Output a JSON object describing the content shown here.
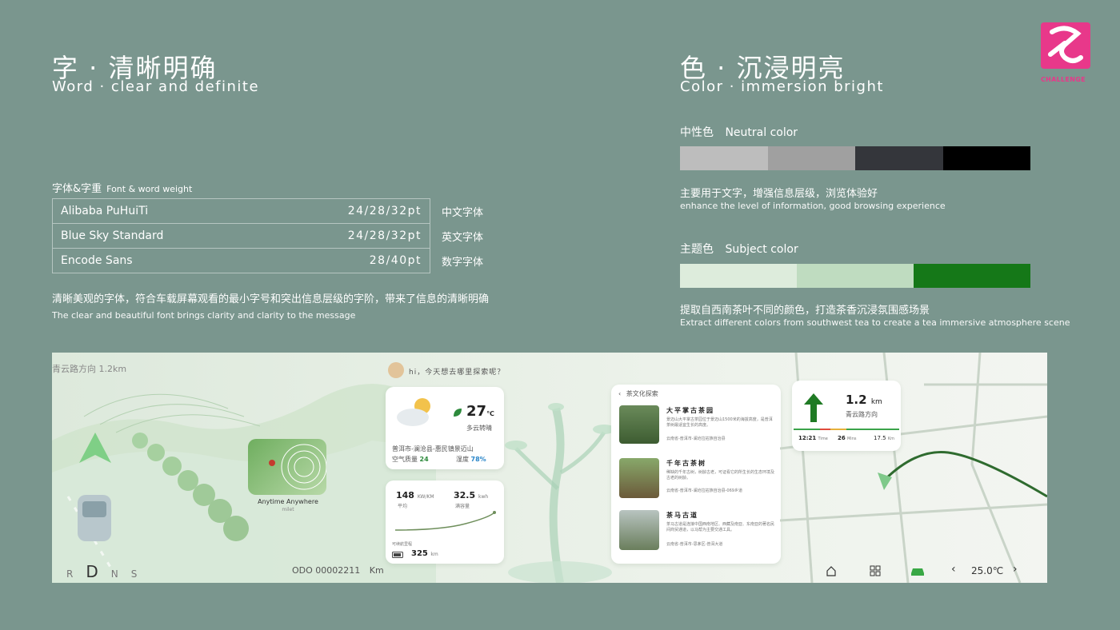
{
  "left": {
    "title_cn": "字 · 清晰明确",
    "title_en": "Word · clear and definite",
    "font_label_cn": "字体&字重",
    "font_label_en": "Font & word weight",
    "fonts": [
      {
        "name": "Alibaba PuHuiTi",
        "size": "24/28/32pt",
        "tag": "中文字体"
      },
      {
        "name": "Blue Sky Standard",
        "size": "24/28/32pt",
        "tag": "英文字体"
      },
      {
        "name": "Encode Sans",
        "size": "28/40pt",
        "tag": "数字字体"
      }
    ],
    "desc_cn": "清晰美观的字体，符合车载屏幕观看的最小字号和突出信息层级的字阶，带来了信息的清晰明确",
    "desc_en": "The clear and beautiful font brings clarity and clarity to the message"
  },
  "right": {
    "title_cn": "色 · 沉浸明亮",
    "title_en": "Color · immersion bright",
    "neutral_label_cn": "中性色",
    "neutral_label_en": "Neutral color",
    "neutral_colors": [
      "#bdbdbd",
      "#a0a0a0",
      "#34363b",
      "#000000"
    ],
    "neutral_desc_cn": "主要用于文字，增强信息层级，浏览体验好",
    "neutral_desc_en": "enhance the level of information, good browsing experience",
    "subject_label_cn": "主题色",
    "subject_label_en": "Subject color",
    "subject_colors": [
      "#ddecdc",
      "#bfdcc0",
      "#157818"
    ],
    "subject_desc_cn": "提取自西南茶叶不同的颜色，打造茶香沉浸氛围感场景",
    "subject_desc_en": "Extract different colors from southwest tea to create a tea immersive atmosphere scene"
  },
  "logo": {
    "text": "CHALLENGE",
    "bg": "#e8388a"
  },
  "dashboard": {
    "nav_hint": "青云路方向  1.2km",
    "gears": [
      "R",
      "D",
      "N",
      "S"
    ],
    "active_gear": "D",
    "odo": "ODO 00002211",
    "odo_unit": "Km",
    "music_title": "Anytime Anywhere",
    "music_artist": "milet",
    "greeting": "hi，今天想去哪里探索呢？",
    "weather": {
      "temp": "27",
      "unit": "℃",
      "cond": "多云转晴",
      "location": "普洱市-澜沧县-惠民镇景迈山",
      "aq_label": "空气质量",
      "aq": "24",
      "hum_label": "湿度",
      "hum": "78%"
    },
    "energy": {
      "consumption": "148",
      "consumption_unit": "KW/KM",
      "consumption_label": "平均",
      "capacity": "32.5",
      "capacity_unit": "kwh",
      "capacity_label": "满容量",
      "range_label": "可续航里程",
      "range": "325",
      "range_unit": "km"
    },
    "tea": {
      "header": "茶文化探索",
      "items": [
        {
          "title": "大平掌古茶园",
          "desc": "景迈山大平掌古茶园位于景迈山1500米的海拔高度，是普洱茶树最适宜生长的高度。",
          "addr": "云南省-普洱市-澜沧拉祜族自治县"
        },
        {
          "title": "千年古茶树",
          "desc": "稀缺的千年古树，树龄古老，可证看它的所生长的生态环境及古老的树龄。",
          "addr": "云南省-普洱市-澜沧拉祜族自治县-069乡道"
        },
        {
          "title": "茶马古道",
          "desc": "茶马古道是连接中国西南地区、西藏及南亚、东南亚的著名民间商贸通道，以马帮为主要交通工具。",
          "addr": "云南省-普洱市-思茅区-普洱大道"
        }
      ]
    },
    "navcard": {
      "dist": "1.2",
      "dist_unit": "km",
      "road": "青云路方向",
      "eta": "12:21",
      "eta_label": "Time",
      "mins": "26",
      "mins_label": "Mins",
      "remain": "17.5",
      "remain_unit": "Km"
    },
    "climate_temp": "25.0℃"
  }
}
